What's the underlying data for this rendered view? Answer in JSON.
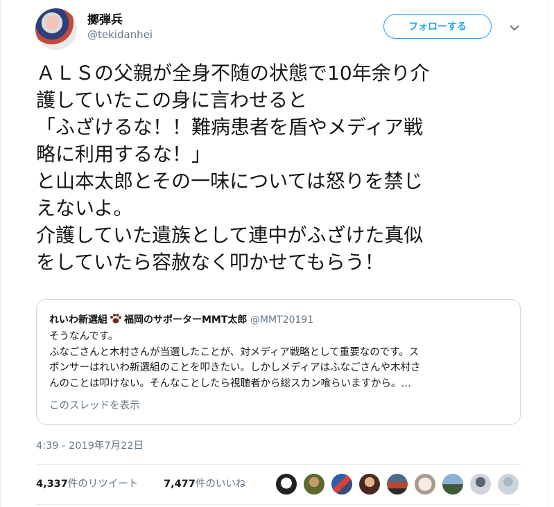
{
  "author": {
    "display_name": "擲弾兵",
    "handle": "@tekidanhei",
    "follow_label": "フォローする"
  },
  "tweet": {
    "text": "ＡＬＳの父親が全身不随の状態で10年余り介\n護していたこの身に言わせると\n「ふざけるな！！難病患者を盾やメディア戦\n略に利用するな！」\nと山本太郎とその一味については怒りを禁じ\nえないよ。\n介護していた遺族として連中がふざけた真似\nをしていたら容赦なく叩かせてもらう！"
  },
  "quote": {
    "name_part1": "れいわ新選組",
    "name_part2": "福岡のサポーターMMT太郎",
    "handle": "@MMT20191",
    "text": "そうなんです。\nふなごさんと木村さんが当選したことが、対メディア戦略として重要なのです。ス\nポンサーはれいわ新選組のことを叩きたい。しかしメディアはふなごさんや木村さ\nんのことは叩けない。そんなことしたら視聴者から総スカン喰らいますから。…",
    "thread_link": "このスレッドを表示"
  },
  "timestamp": "4:39 - 2019年7月22日",
  "stats": {
    "retweets_count": "4,337",
    "retweets_label": "件のリツイート",
    "likes_count": "7,477",
    "likes_label": "件のいいね"
  },
  "colors": {
    "accent": "#1da1f2",
    "secondary_text": "#657786",
    "border": "#ccd6dd"
  },
  "icons": [
    "chevron-down-icon",
    "paw-icon"
  ]
}
